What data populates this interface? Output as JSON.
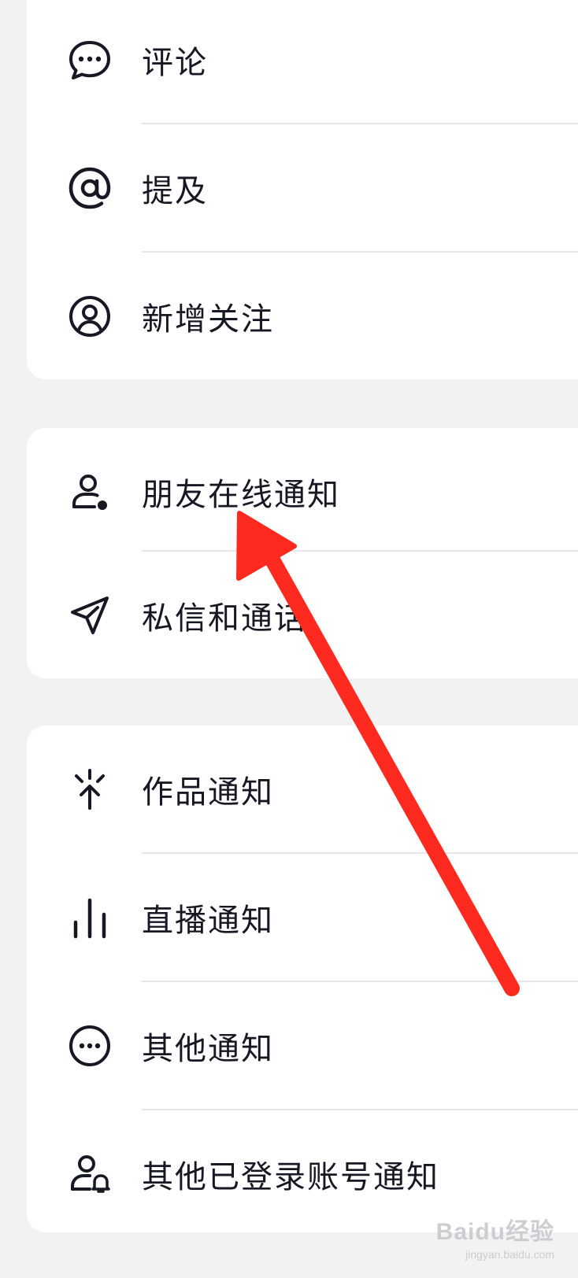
{
  "sections": [
    {
      "items": [
        {
          "label": "评论",
          "icon": "comment-icon"
        },
        {
          "label": "提及",
          "icon": "at-icon"
        },
        {
          "label": "新增关注",
          "icon": "user-circle-icon"
        }
      ]
    },
    {
      "items": [
        {
          "label": "朋友在线通知",
          "icon": "user-online-icon"
        },
        {
          "label": "私信和通话",
          "icon": "send-icon"
        }
      ]
    },
    {
      "items": [
        {
          "label": "作品通知",
          "icon": "works-spark-icon"
        },
        {
          "label": "直播通知",
          "icon": "live-bars-icon"
        },
        {
          "label": "其他通知",
          "icon": "more-circle-icon"
        },
        {
          "label": "其他已登录账号通知",
          "icon": "user-bell-icon"
        }
      ]
    }
  ],
  "annotation": {
    "color": "#ff2a1f",
    "points_to": "朋友在线通知"
  },
  "watermark": {
    "main": "Baidu经验",
    "sub": "jingyan.baidu.com"
  },
  "colors": {
    "background": "#f2f2f3",
    "card": "#ffffff",
    "text": "#161823",
    "divider": "#e6e6e8"
  }
}
